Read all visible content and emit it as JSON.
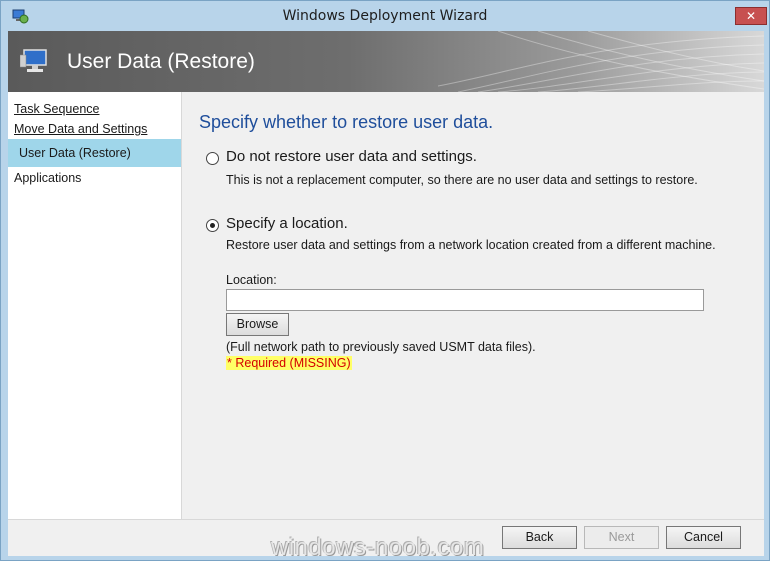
{
  "window": {
    "title": "Windows Deployment Wizard",
    "close_label": "✕",
    "accent_color": "#b8d4ea"
  },
  "header": {
    "title": "User Data (Restore)",
    "icon": "computer-icon"
  },
  "sidebar": {
    "items": [
      {
        "label": "Task Sequence",
        "state": "link"
      },
      {
        "label": "Move Data and Settings",
        "state": "link"
      },
      {
        "label": "User Data (Restore)",
        "state": "active"
      },
      {
        "label": "Applications",
        "state": "plain"
      }
    ],
    "active_color": "#9fd6ea"
  },
  "main": {
    "heading": "Specify whether to restore user data.",
    "options": [
      {
        "label": "Do not restore user data and settings.",
        "description": "This is not a replacement computer, so there are no user data and settings to restore.",
        "selected": false
      },
      {
        "label": "Specify a location.",
        "description": "Restore user data and settings from a network location created from a different machine.",
        "selected": true
      }
    ],
    "location_label": "Location:",
    "location_value": "",
    "browse_label": "Browse",
    "note": "(Full network path to previously saved USMT data files).",
    "required_text": "* Required (MISSING)"
  },
  "footer": {
    "back_label": "Back",
    "next_label": "Next",
    "cancel_label": "Cancel"
  },
  "watermark": "windows-noob.com"
}
